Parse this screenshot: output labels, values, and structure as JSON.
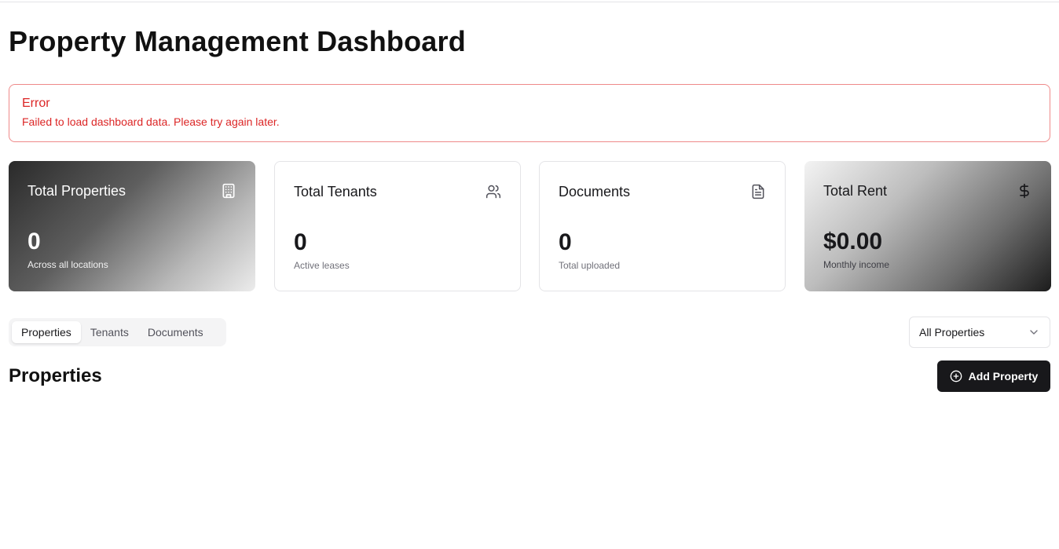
{
  "page": {
    "title": "Property Management Dashboard"
  },
  "error": {
    "title": "Error",
    "message": "Failed to load dashboard data. Please try again later."
  },
  "stats": [
    {
      "title": "Total Properties",
      "value": "0",
      "subtitle": "Across all locations",
      "icon": "building-icon"
    },
    {
      "title": "Total Tenants",
      "value": "0",
      "subtitle": "Active leases",
      "icon": "users-icon"
    },
    {
      "title": "Documents",
      "value": "0",
      "subtitle": "Total uploaded",
      "icon": "file-text-icon"
    },
    {
      "title": "Total Rent",
      "value": "$0.00",
      "subtitle": "Monthly income",
      "icon": "dollar-icon"
    }
  ],
  "tabs": [
    {
      "label": "Properties",
      "active": true
    },
    {
      "label": "Tenants",
      "active": false
    },
    {
      "label": "Documents",
      "active": false
    }
  ],
  "filter": {
    "selected": "All Properties",
    "icon": "chevron-down-icon"
  },
  "section": {
    "title": "Properties"
  },
  "add_button": {
    "label": "Add Property",
    "icon": "plus-circle-icon"
  },
  "colors": {
    "error": "#dc2626",
    "primary": "#18181b",
    "border": "#e4e4e7"
  }
}
